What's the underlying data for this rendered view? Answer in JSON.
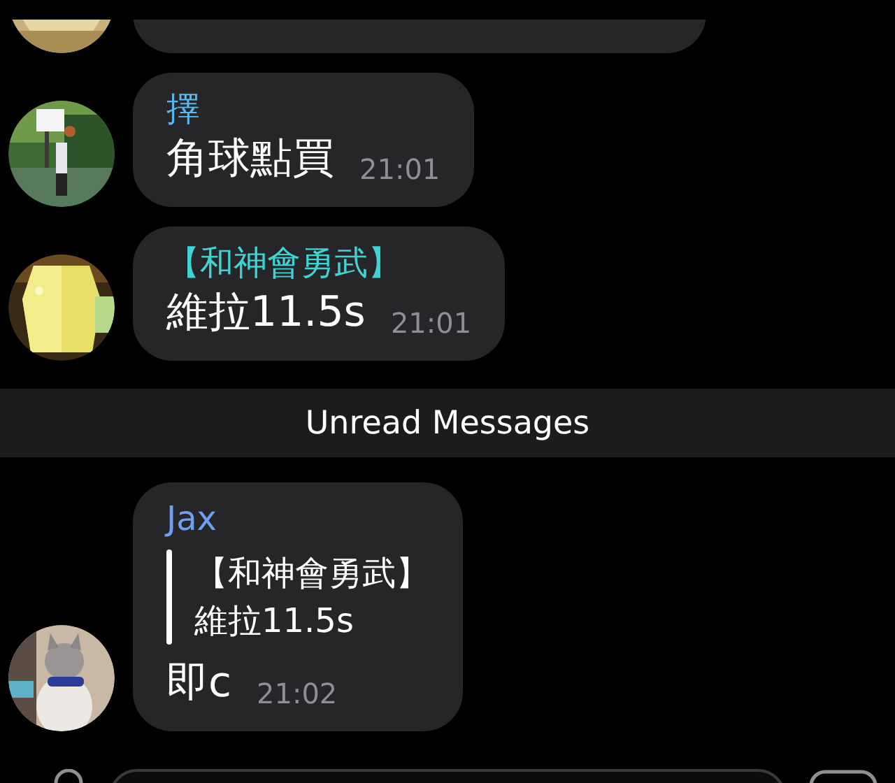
{
  "chat": [
    {
      "kind": "cut_off"
    },
    {
      "kind": "message",
      "sender": "擇",
      "color": "#5ab8f0",
      "text": "角球點買",
      "time": "21:01"
    },
    {
      "kind": "message",
      "sender": "【和神會勇武】",
      "color": "#3fd3d3",
      "text": "維拉11.5s",
      "time": "21:01"
    },
    {
      "kind": "divider",
      "text": "Unread Messages"
    },
    {
      "kind": "message",
      "sender": "Jax",
      "color": "#6f9ef5",
      "reply": {
        "sender": "【和神會勇武】",
        "text": "維拉11.5s"
      },
      "text": "即c",
      "time": "21:02"
    }
  ]
}
